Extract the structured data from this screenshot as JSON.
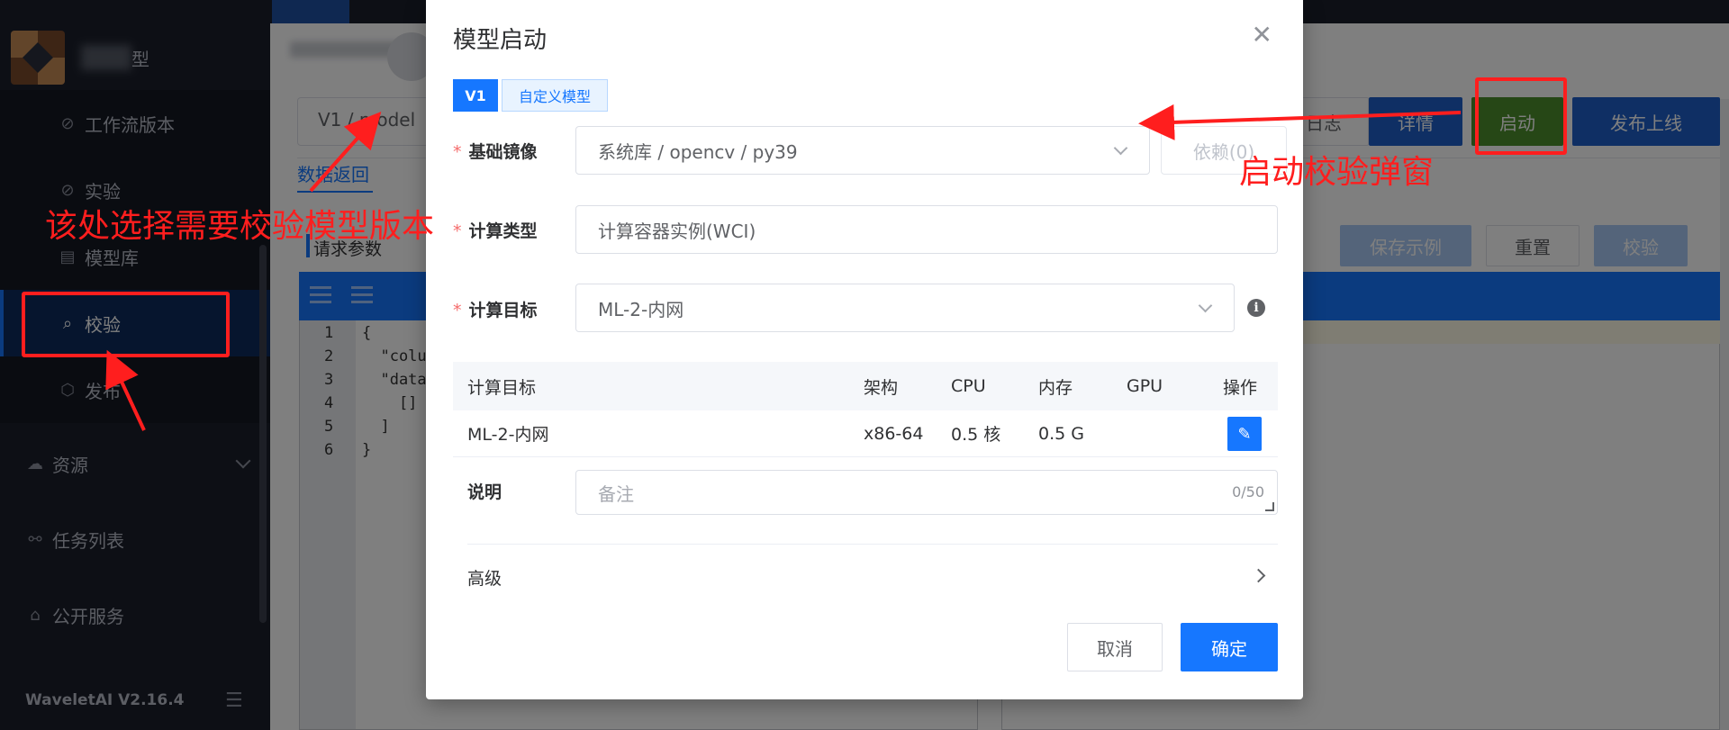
{
  "sidebar": {
    "brand_suffix": "型",
    "items": [
      {
        "label": "工作流版本",
        "icon": "workflow-icon"
      },
      {
        "label": "实验",
        "icon": "experiment-icon"
      },
      {
        "label": "模型库",
        "icon": "model-library-icon"
      },
      {
        "label": "校验",
        "icon": "verify-scan-icon",
        "active": true
      },
      {
        "label": "发布",
        "icon": "cube-publish-icon"
      },
      {
        "label": "资源",
        "icon": "cloud-resource-icon"
      },
      {
        "label": "任务列表",
        "icon": "task-list-icon"
      },
      {
        "label": "公开服务",
        "icon": "public-service-icon"
      }
    ],
    "version": "WaveletAI V2.16.4"
  },
  "background": {
    "version_select": "V1 / model",
    "tab_data": "数据返回",
    "request_params": "请求参数",
    "buttons": {
      "log": "日志",
      "detail": "详情",
      "start": "启动",
      "publish": "发布上线",
      "save_example": "保存示例",
      "reset": "重置",
      "check": "校验"
    },
    "code_lines": [
      "{",
      "  \"colu",
      "  \"data",
      "    []",
      "  ]",
      "}"
    ],
    "line_numbers": [
      "1",
      "2",
      "3",
      "4",
      "5",
      "6"
    ]
  },
  "dialog": {
    "title": "模型启动",
    "version_tabs": [
      "V1",
      "自定义模型"
    ],
    "base_image_label": "基础镜像",
    "base_image_value": "系统库 / opencv / py39",
    "dependency_button": "依赖(0)",
    "compute_type_label": "计算类型",
    "compute_type_value": "计算容器实例(WCI)",
    "compute_target_label": "计算目标",
    "compute_target_value": "ML-2-内网",
    "info_glyph": "i",
    "table": {
      "headers": [
        "计算目标",
        "架构",
        "CPU",
        "内存",
        "GPU",
        "操作"
      ],
      "rows": [
        {
          "target": "ML-2-内网",
          "arch": "x86-64",
          "cpu": "0.5 核",
          "memory": "0.5 G",
          "gpu": ""
        }
      ]
    },
    "remark_label": "说明",
    "remark_placeholder": "备注",
    "remark_count": "0/50",
    "advanced_label": "高级",
    "cancel": "取消",
    "confirm": "确定"
  },
  "annotations": {
    "left_text": "该处选择需要校验模型版本",
    "right_text": "启动校验弹窗",
    "color": "#ff1e1e"
  }
}
